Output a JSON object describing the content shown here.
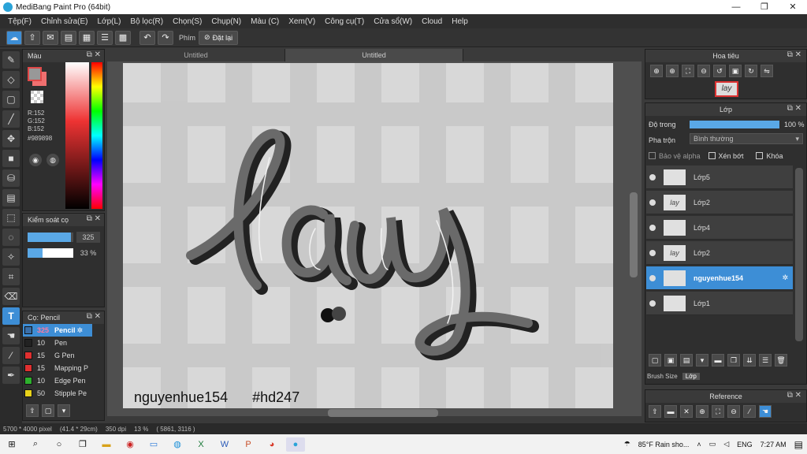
{
  "window": {
    "title": "MediBang Paint Pro (64bit)",
    "minimize": "—",
    "maximize": "❐",
    "close": "✕"
  },
  "menu": [
    "Tệp(F)",
    "Chỉnh sửa(E)",
    "Lớp(L)",
    "Bộ lọc(R)",
    "Chọn(S)",
    "Chụp(N)",
    "Màu (C)",
    "Xem(V)",
    "Công cụ(T)",
    "Cửa sổ(W)",
    "Cloud",
    "Help"
  ],
  "toolbar": {
    "shortcut_label": "Phím",
    "reset_label": "Đặt lại"
  },
  "color_panel": {
    "title": "Màu",
    "r": "R:152",
    "g": "G:152",
    "b": "B:152",
    "hex": "#989898",
    "colors": {
      "foreground": "#989898",
      "background": "#f07070"
    }
  },
  "brush_control": {
    "title": "Kiểm soát cọ",
    "size": "325",
    "size_fraction": 0.95,
    "opacity": "33 %",
    "opacity_fraction": 0.33
  },
  "brush_list": {
    "title": "Cọ: Pencil",
    "items": [
      {
        "size": "325",
        "name": "Pencil",
        "color": "#3a6fa8",
        "active": true
      },
      {
        "size": "10",
        "name": "Pen",
        "color": "#222222"
      },
      {
        "size": "15",
        "name": "G Pen",
        "color": "#e03030"
      },
      {
        "size": "15",
        "name": "Mapping P",
        "color": "#e03030"
      },
      {
        "size": "10",
        "name": "Edge Pen",
        "color": "#2db02d"
      },
      {
        "size": "50",
        "name": "Stipple Pe",
        "color": "#e8d21a"
      }
    ]
  },
  "doc_tabs": [
    "Untitled",
    "Untitled"
  ],
  "canvas": {
    "signature": "nguyenhue154",
    "hashtag": "#hd247"
  },
  "navigator": {
    "title": "Hoa tiêu",
    "thumb_label": "lay"
  },
  "layer_panel": {
    "title": "Lớp",
    "opacity_label": "Độ trong",
    "opacity_value": "100 %",
    "opacity_fraction": 1.0,
    "blend_label": "Pha trộn",
    "blend_value": "Bình thường",
    "protect_alpha": "Bảo vệ alpha",
    "clipping": "Xén bớt",
    "lock": "Khóa",
    "layers": [
      {
        "name": "Lớp5",
        "thumb": ""
      },
      {
        "name": "Lớp2",
        "thumb": "lay"
      },
      {
        "name": "Lớp4",
        "thumb": ""
      },
      {
        "name": "Lớp2",
        "thumb": "lay"
      },
      {
        "name": "nguyenhue154",
        "thumb": "",
        "selected": true
      },
      {
        "name": "Lớp1",
        "thumb": ""
      }
    ],
    "tab_brush_size": "Brush Size",
    "tab_layer": "Lớp"
  },
  "reference": {
    "title": "Reference"
  },
  "status": {
    "size": "5700 * 4000 pixel",
    "physical": "(41.4 * 29cm)",
    "dpi": "350 dpi",
    "zoom": "13 %",
    "coords": "( 5861, 3116 )"
  },
  "taskbar": {
    "weather": "85°F  Rain sho...",
    "lang": "ENG",
    "time": "7:27 AM"
  }
}
